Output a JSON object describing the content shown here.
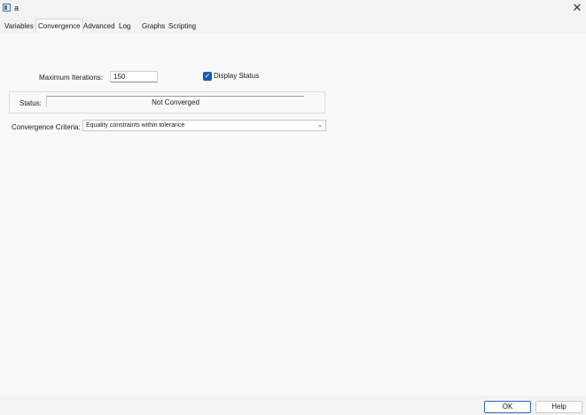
{
  "window": {
    "title": "a",
    "close_glyph": "✕"
  },
  "tabs": [
    {
      "label": "Variables"
    },
    {
      "label": "Convergence"
    },
    {
      "label": "Advanced"
    },
    {
      "label": "Log"
    },
    {
      "label": "Graphs"
    },
    {
      "label": "Scripting"
    }
  ],
  "active_tab": "Convergence",
  "form": {
    "max_iterations_label": "Maximum Iterations:",
    "max_iterations_value": "150",
    "display_status_label": "Display Status",
    "display_status_checked": true,
    "status_label": "Status:",
    "status_value": "Not Converged",
    "criteria_label": "Convergence Criteria:",
    "criteria_value": "Equality constraints within tolerance"
  },
  "buttons": {
    "ok": "OK",
    "help": "Help"
  },
  "colors": {
    "accent": "#0f5fb3",
    "background": "#f3f3f3",
    "panel": "#f9f9f9"
  }
}
